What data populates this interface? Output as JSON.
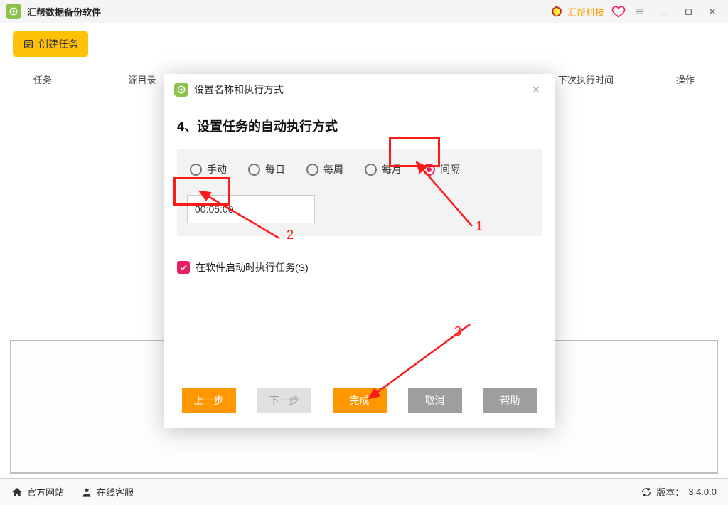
{
  "titlebar": {
    "app_name": "汇帮数据备份软件",
    "brand_text": "汇帮科技"
  },
  "toolbar": {
    "create_task": "创建任务"
  },
  "columns": {
    "c1": "任务",
    "c2": "源目录",
    "c3": "下次执行时间",
    "c4": "操作"
  },
  "statusbar": {
    "site": "官方网站",
    "support": "在线客服",
    "version_label": "版本：",
    "version_value": "3.4.0.0"
  },
  "modal": {
    "title": "设置名称和执行方式",
    "step_title": "4、设置任务的自动执行方式",
    "radios": {
      "manual": "手动",
      "daily": "每日",
      "weekly": "每周",
      "monthly": "每月",
      "interval": "间隔"
    },
    "time_value": "00:05:00",
    "run_on_start": "在软件启动时执行任务(S)",
    "buttons": {
      "prev": "上一步",
      "next": "下一步",
      "finish": "完成",
      "cancel": "取消",
      "help": "帮助"
    }
  },
  "annotations": {
    "n1": "1",
    "n2": "2",
    "n3": "3"
  }
}
